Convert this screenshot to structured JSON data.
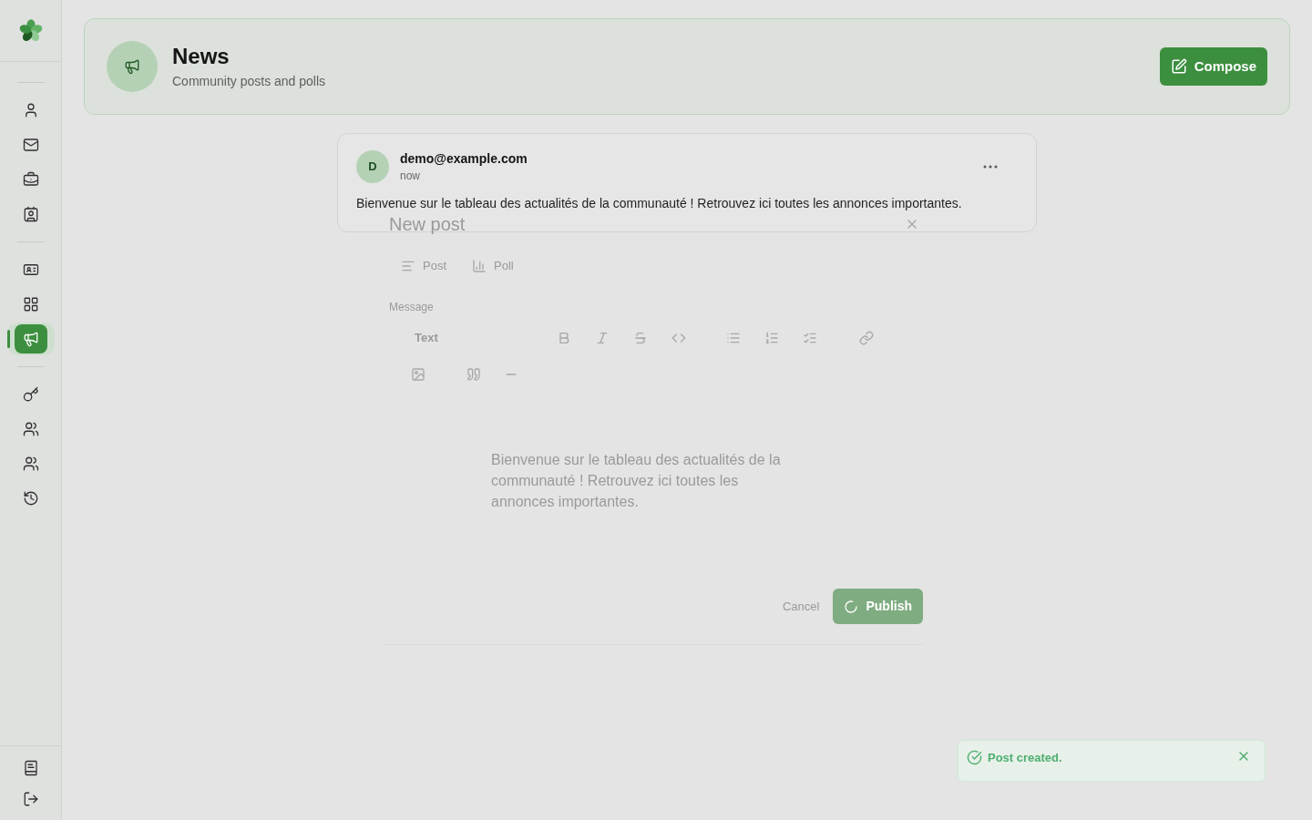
{
  "sidebar": {
    "groups": [
      {
        "items": [
          {
            "selected": false
          },
          {
            "selected": false
          },
          {
            "selected": false
          },
          {
            "selected": false
          }
        ]
      },
      {
        "items": [
          {
            "selected": false
          },
          {
            "selected": false
          },
          {
            "selected": true
          }
        ]
      },
      {
        "items": [
          {
            "selected": false
          },
          {
            "selected": false
          },
          {
            "selected": false
          },
          {
            "selected": false
          }
        ]
      }
    ]
  },
  "header": {
    "title": "News",
    "subtitle": "Community posts and polls",
    "compose_button": "Compose"
  },
  "posts": [
    {
      "avatar_initial": "D",
      "author": "demo@example.com",
      "time": "now",
      "body": "Bienvenue sur le tableau des actualités de la communauté ! Retrouvez ici toutes les annonces importantes."
    }
  ],
  "closing_dialog": {
    "title": "New post",
    "tabs": [
      "Post",
      "Poll"
    ],
    "field_label": "Message",
    "block_type": "Text",
    "message": "Bienvenue sur le tableau des actualités de la communauté ! Retrouvez ici toutes les annonces importantes.",
    "cancel_button": "Cancel",
    "publish_button": "Publish"
  },
  "toast": {
    "message": "Post created."
  }
}
